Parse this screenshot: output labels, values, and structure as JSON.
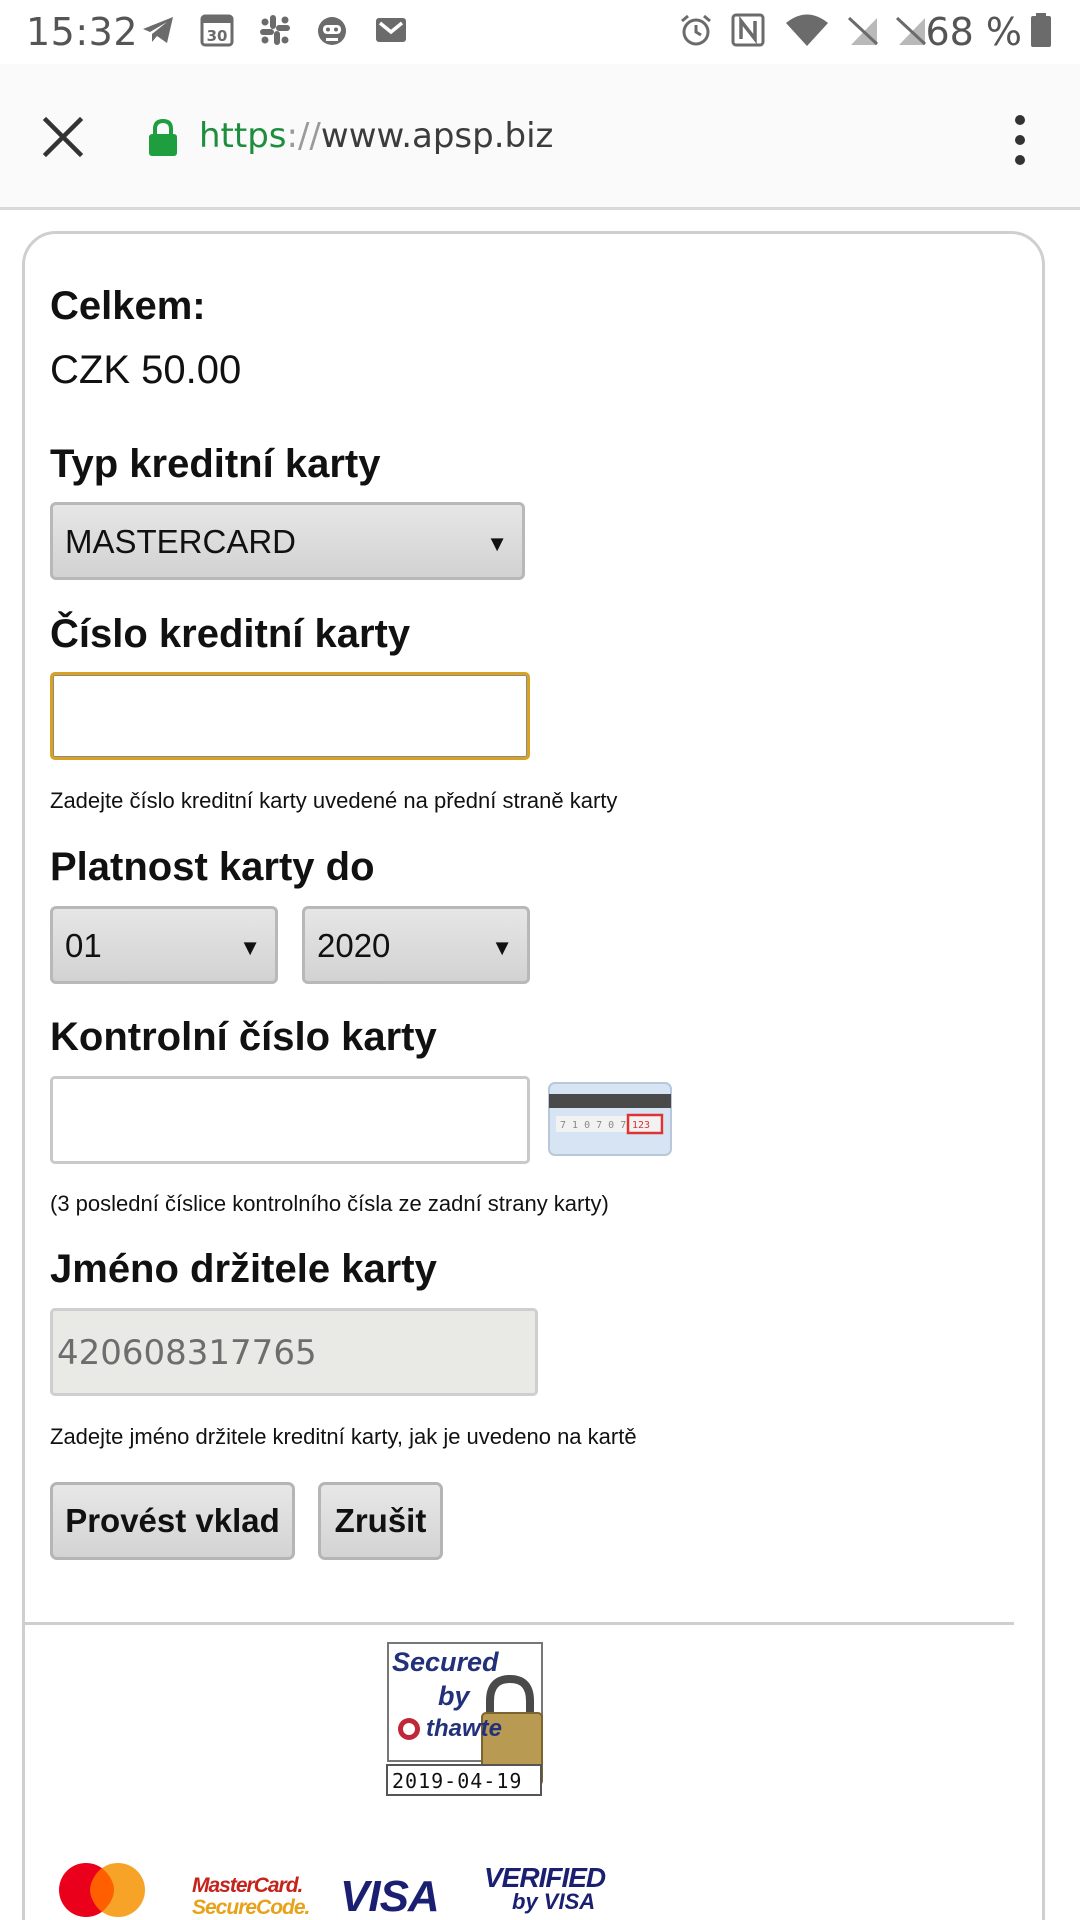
{
  "status_bar": {
    "time": "15:32",
    "battery": "68 %",
    "left_icons": [
      "telegram-icon",
      "calendar-30-icon",
      "slack-icon",
      "robot-icon",
      "gmail-icon"
    ],
    "right_icons": [
      "alarm-icon",
      "nfc-icon",
      "wifi-icon",
      "no-sim-icon",
      "no-sim-icon",
      "battery-icon"
    ]
  },
  "toolbar": {
    "url_scheme": "https",
    "url_sep": "://",
    "url_host": "www.apsp.biz"
  },
  "form": {
    "total_label": "Celkem:",
    "total_value": "CZK 50.00",
    "card_type_label": "Typ kreditní karty",
    "card_type_value": "MASTERCARD",
    "card_number_label": "Číslo kreditní karty",
    "card_number_hint": "Zadejte číslo kreditní karty uvedené na přední straně karty",
    "expiry_label": "Platnost karty do",
    "expiry_month": "01",
    "expiry_year": "2020",
    "cvv_label": "Kontrolní číslo karty",
    "cvv_hint": "(3 poslední číslice kontrolního čísla ze zadní strany karty)",
    "holder_label": "Jméno držitele karty",
    "holder_value": "420608317765",
    "holder_hint": "Zadejte jméno držitele kreditní karty, jak je uvedeno na kartě",
    "submit_label": "Provést vklad",
    "cancel_label": "Zrušit"
  },
  "seal": {
    "line1": "Secured",
    "line2": "by",
    "brand": "thawte",
    "date": "2019-04-19"
  },
  "payment_logos": {
    "mastercard_securecode_line1": "MasterCard.",
    "mastercard_securecode_line2": "SecureCode.",
    "visa": "VISA",
    "verified_line1": "VERIFIED",
    "verified_line2": "by VISA"
  },
  "colors": {
    "https_green": "#1e8e3e",
    "focus_border": "#d9a321",
    "lock_green": "#1e9e3e"
  }
}
